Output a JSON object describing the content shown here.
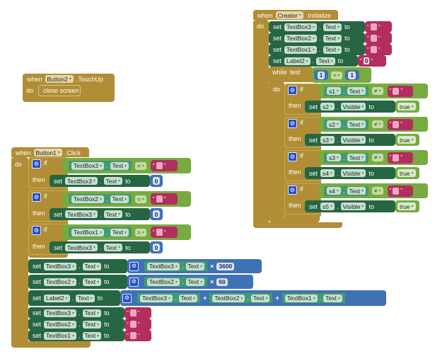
{
  "colors": {
    "event": "#b18e35",
    "setter": "#266643",
    "getter": "#439970",
    "logic": "#77ab41",
    "math": "#3f71b5",
    "text": "#b32d5e"
  },
  "kw": {
    "when": "when",
    "do": "do",
    "set": "set",
    "to": "to",
    "if": "if",
    "then": "then",
    "while": "while",
    "test": "test",
    "dot": ".",
    "close_screen": "close screen",
    "times": "×",
    "plus": "+",
    "eq": "=",
    "neq": "≠",
    "true": "true",
    "gear": "⚙"
  },
  "creator_init": {
    "component": "Creator",
    "event": ".Initialize",
    "sets": [
      {
        "comp": "TextBox3",
        "prop": "Text",
        "value": ""
      },
      {
        "comp": "TextBox2",
        "prop": "Text",
        "value": ""
      },
      {
        "comp": "TextBox1",
        "prop": "Text",
        "value": ""
      },
      {
        "comp": "Label2",
        "prop": "Text",
        "value": "0"
      }
    ],
    "while_test": {
      "left": "1",
      "op": "=",
      "right": "1"
    },
    "ifs": [
      {
        "cond_comp": "s1",
        "cond_prop": "Text",
        "op": "≠",
        "set_comp": "s2",
        "set_prop": "Visible",
        "value": "true"
      },
      {
        "cond_comp": "s2",
        "cond_prop": "Text",
        "op": "≠",
        "set_comp": "s3",
        "set_prop": "Visible",
        "value": "true"
      },
      {
        "cond_comp": "s3",
        "cond_prop": "Text",
        "op": "≠",
        "set_comp": "s4",
        "set_prop": "Visible",
        "value": "true"
      },
      {
        "cond_comp": "s4",
        "cond_prop": "Text",
        "op": "≠",
        "set_comp": "s5",
        "set_prop": "Visible",
        "value": "true"
      }
    ]
  },
  "button2_touchup": {
    "component": "Button2",
    "event": ".TouchUp"
  },
  "button1_click": {
    "component": "Button1",
    "event": ".Click",
    "ifs": [
      {
        "cond_comp": "TextBox3",
        "cond_prop": "Text",
        "op": "=",
        "set_comp": "TextBox3",
        "set_prop": "Text",
        "value": "0"
      },
      {
        "cond_comp": "TextBox2",
        "cond_prop": "Text",
        "op": "=",
        "set_comp": "TextBox3",
        "set_prop": "Text",
        "value": "0"
      },
      {
        "cond_comp": "TextBox1",
        "cond_prop": "Text",
        "op": "=",
        "set_comp": "TextBox3",
        "set_prop": "Text",
        "value": "0"
      }
    ],
    "mult_sets": [
      {
        "comp": "TextBox3",
        "prop": "Text",
        "get_comp": "TextBox3",
        "get_prop": "Text",
        "factor": "3600"
      },
      {
        "comp": "TextBox2",
        "prop": "Text",
        "get_comp": "TextBox2",
        "get_prop": "Text",
        "factor": "60"
      }
    ],
    "sum_set": {
      "comp": "Label2",
      "prop": "Text",
      "terms": [
        {
          "comp": "TextBox3",
          "prop": "Text"
        },
        {
          "comp": "TextBox2",
          "prop": "Text"
        },
        {
          "comp": "TextBox1",
          "prop": "Text"
        }
      ]
    },
    "clear_sets": [
      {
        "comp": "TextBox3",
        "prop": "Text",
        "value": ""
      },
      {
        "comp": "TextBox2",
        "prop": "Text",
        "value": ""
      },
      {
        "comp": "TextBox1",
        "prop": "Text",
        "value": ""
      }
    ]
  }
}
